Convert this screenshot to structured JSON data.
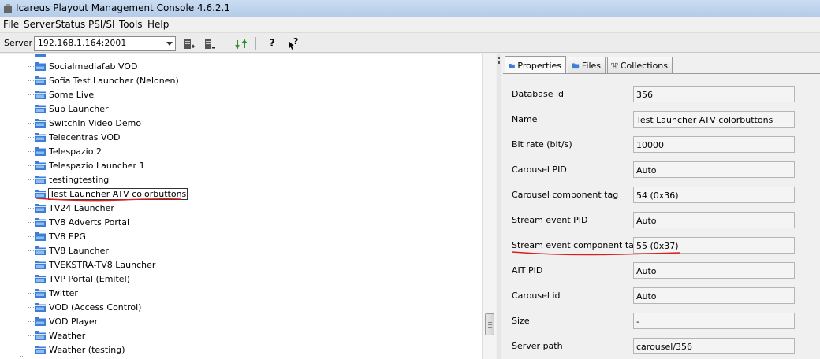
{
  "window": {
    "title": "Icareus Playout Management Console 4.6.2.1"
  },
  "menu": [
    "File",
    "Server",
    "Status",
    "PSI/SI",
    "Tools",
    "Help"
  ],
  "toolbar": {
    "server_label": "Server",
    "server_value": "192.168.1.164:2001",
    "buttons": [
      "add-server-icon",
      "remove-server-icon",
      "refresh-icon",
      "help-icon",
      "context-help-icon"
    ],
    "help_glyph": "?",
    "context_help_glyph": "?"
  },
  "tree": {
    "items": [
      "Socialmediafab VOD",
      "Sofia Test Launcher (Nelonen)",
      "Some Live",
      "Sub Launcher",
      "SwitchIn Video Demo",
      "Telecentras VOD",
      "Telespazio 2",
      "Telespazio Launcher 1",
      "testingtesting",
      "Test Launcher ATV colorbuttons",
      "TV24 Launcher",
      "TV8 Adverts Portal",
      "TV8 EPG",
      "TV8 Launcher",
      "TVEKSTRA-TV8 Launcher",
      "TVP Portal (Emitel)",
      "Twitter",
      "VOD (Access Control)",
      "VOD Player",
      "Weather",
      "Weather (testing)"
    ],
    "selected": "Test Launcher ATV colorbuttons"
  },
  "tabs": [
    "Properties",
    "Files",
    "Collections"
  ],
  "active_tab": "Properties",
  "properties": [
    {
      "label": "Database id",
      "value": "356"
    },
    {
      "label": "Name",
      "value": "Test Launcher ATV colorbuttons"
    },
    {
      "label": "Bit rate (bit/s)",
      "value": "10000"
    },
    {
      "label": "Carousel PID",
      "value": "Auto"
    },
    {
      "label": "Carousel component tag",
      "value": "54 (0x36)"
    },
    {
      "label": "Stream event PID",
      "value": "Auto"
    },
    {
      "label": "Stream event component tag",
      "value": "55 (0x37)"
    },
    {
      "label": "AIT PID",
      "value": "Auto"
    },
    {
      "label": "Carousel id",
      "value": "Auto"
    },
    {
      "label": "Size",
      "value": "-"
    },
    {
      "label": "Server path",
      "value": "carousel/356"
    }
  ],
  "colors": {
    "annotation_red": "#d42020",
    "folder_blue": "#3d7fd6"
  }
}
